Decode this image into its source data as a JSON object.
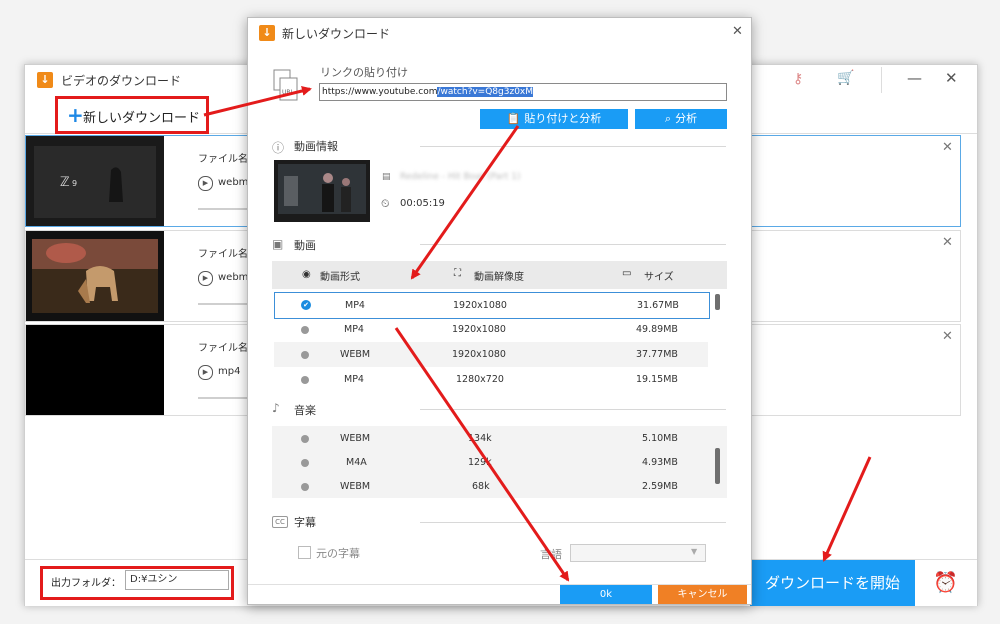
{
  "main_window": {
    "title": "ビデオのダウンロード",
    "new_download_label": "新しいダウンロード",
    "items": [
      {
        "file_label": "ファイル名: S",
        "format": "webm"
      },
      {
        "file_label": "ファイル名: D",
        "format": "webm"
      },
      {
        "file_label": "ファイル名: T",
        "format": "mp4"
      }
    ],
    "output_folder_label": "出力フォルダ：",
    "output_folder_value": "D:¥ユシン",
    "start_button": "ダウンロードを開始"
  },
  "dialog": {
    "title": "新しいダウンロード",
    "paste_link_label": "リンクの貼り付け",
    "url_prefix": "https://www.youtube.com",
    "url_selected": "/watch?v=Q8g3z0xM",
    "paste_analyze_button": "貼り付けと分析",
    "analyze_button": "分析",
    "video_info_label": "動画情報",
    "video_title_blurred": "Redeline - Hit Boat (Part 1)",
    "duration": "00:05:19",
    "video_section_label": "動画",
    "video_table": {
      "columns": [
        "動画形式",
        "動画解像度",
        "サイズ"
      ],
      "rows": [
        {
          "format": "MP4",
          "resolution": "1920x1080",
          "size": "31.67MB",
          "selected": true
        },
        {
          "format": "MP4",
          "resolution": "1920x1080",
          "size": "49.89MB",
          "selected": false
        },
        {
          "format": "WEBM",
          "resolution": "1920x1080",
          "size": "37.77MB",
          "selected": false
        },
        {
          "format": "MP4",
          "resolution": "1280x720",
          "size": "19.15MB",
          "selected": false
        }
      ]
    },
    "music_section_label": "音楽",
    "music_table": {
      "rows": [
        {
          "format": "WEBM",
          "bitrate": "134k",
          "size": "5.10MB"
        },
        {
          "format": "M4A",
          "bitrate": "129k",
          "size": "4.93MB"
        },
        {
          "format": "WEBM",
          "bitrate": "68k",
          "size": "2.59MB"
        }
      ]
    },
    "subtitle_section_label": "字幕",
    "original_subtitle_label": "元の字幕",
    "language_label": "言語",
    "ok_button": "0k",
    "cancel_button": "キャンセル"
  }
}
